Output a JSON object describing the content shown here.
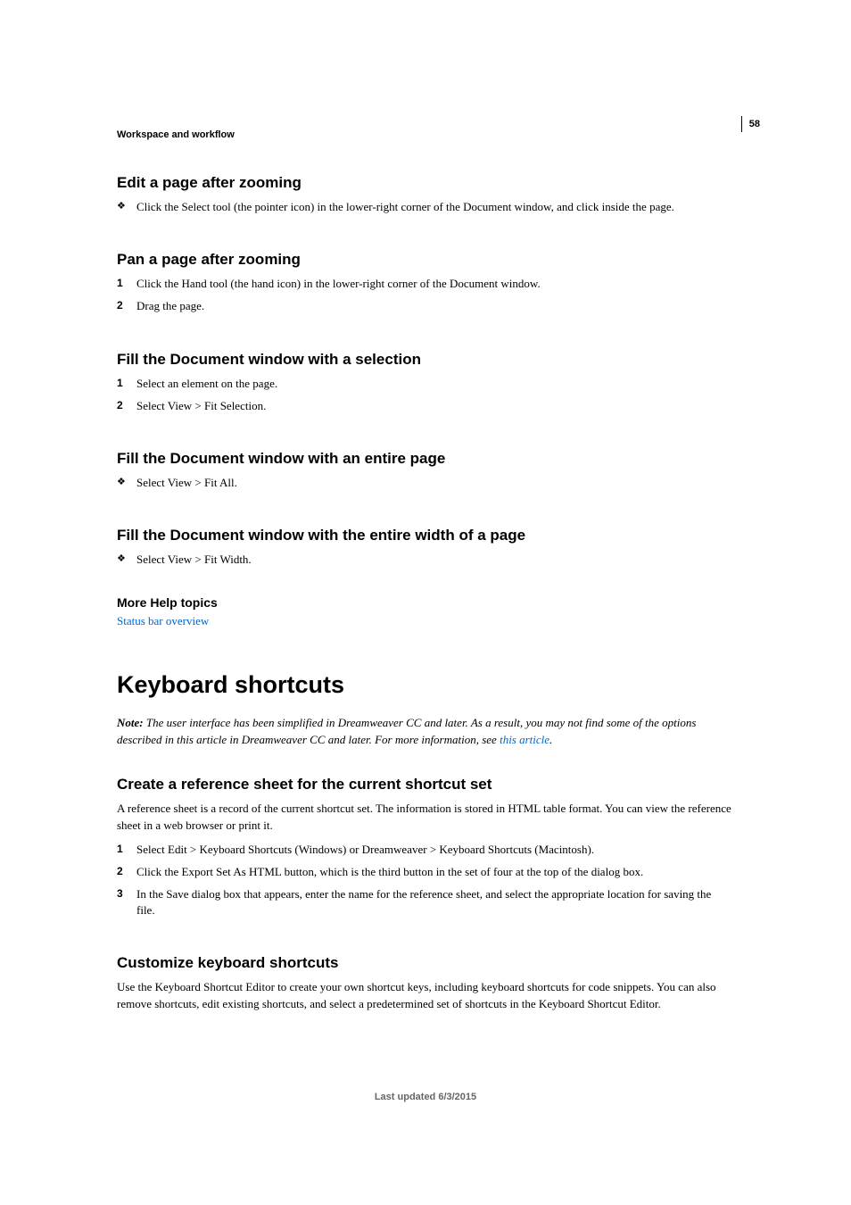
{
  "header": {
    "label": "Workspace and workflow",
    "page_number": "58"
  },
  "sections": [
    {
      "title": "Edit a page after zooming",
      "items": [
        {
          "marker": "❖",
          "type": "bullet",
          "text": "Click the Select tool (the pointer icon) in the lower-right corner of the Document window, and click inside the page."
        }
      ]
    },
    {
      "title": "Pan a page after zooming",
      "items": [
        {
          "marker": "1",
          "type": "num",
          "text": "Click the Hand tool (the hand icon) in the lower-right corner of the Document window."
        },
        {
          "marker": "2",
          "type": "num",
          "text": "Drag the page."
        }
      ]
    },
    {
      "title": "Fill the Document window with a selection",
      "items": [
        {
          "marker": "1",
          "type": "num",
          "text": "Select an element on the page."
        },
        {
          "marker": "2",
          "type": "num",
          "text": "Select View > Fit Selection."
        }
      ]
    },
    {
      "title": "Fill the Document window with an entire page",
      "items": [
        {
          "marker": "❖",
          "type": "bullet",
          "text": "Select View > Fit All."
        }
      ]
    },
    {
      "title": "Fill the Document window with the entire width of a page",
      "items": [
        {
          "marker": "❖",
          "type": "bullet",
          "text": "Select View > Fit Width."
        }
      ]
    }
  ],
  "more_help": {
    "heading": "More Help topics",
    "link": "Status bar overview"
  },
  "keyboard": {
    "title": "Keyboard shortcuts",
    "note_label": "Note:",
    "note_text_1": " The user interface has been simplified in Dreamweaver CC and later. As a result, you may not find some of the options described in this article in Dreamweaver CC and later. For more information, see ",
    "note_link": "this article",
    "note_text_2": "."
  },
  "ref_sheet": {
    "title": "Create a reference sheet for the current shortcut set",
    "para": "A reference sheet is a record of the current shortcut set. The information is stored in HTML table format. You can view the reference sheet in a web browser or print it.",
    "items": [
      {
        "marker": "1",
        "text": "Select Edit > Keyboard Shortcuts (Windows) or Dreamweaver > Keyboard Shortcuts (Macintosh)."
      },
      {
        "marker": "2",
        "text": "Click the Export Set As HTML button, which is the third button in the set of four at the top of the dialog box."
      },
      {
        "marker": "3",
        "text": "In the Save dialog box that appears, enter the name for the reference sheet, and select the appropriate location for saving the file."
      }
    ]
  },
  "customize": {
    "title": "Customize keyboard shortcuts",
    "para": "Use the Keyboard Shortcut Editor to create your own shortcut keys, including keyboard shortcuts for code snippets. You can also remove shortcuts, edit existing shortcuts, and select a predetermined set of shortcuts in the Keyboard Shortcut Editor."
  },
  "footer": "Last updated 6/3/2015"
}
